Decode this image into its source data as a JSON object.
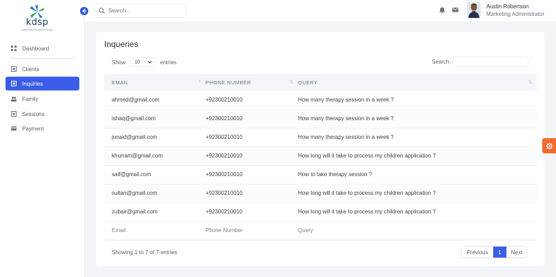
{
  "brand": {
    "logo_text": "kdsp",
    "tagline": "Kashif's Down Syndrome Program"
  },
  "sidebar": {
    "items": [
      {
        "label": "Dashboard",
        "icon": "grid-icon"
      },
      {
        "label": "Clients",
        "icon": "square-icon"
      },
      {
        "label": "Inquiries",
        "icon": "square-icon"
      },
      {
        "label": "Family",
        "icon": "users-icon"
      },
      {
        "label": "Sessions",
        "icon": "square-icon"
      },
      {
        "label": "Payment",
        "icon": "card-icon"
      }
    ],
    "active": "Inquiries"
  },
  "topbar": {
    "search_placeholder": "Search...",
    "user_name": "Austin Robertson",
    "user_role": "Marketing Administrator"
  },
  "page": {
    "title": "Inqueries",
    "show_label": "Show",
    "entries_select": "10",
    "entries_label": "entries",
    "search_label": "Search:"
  },
  "table": {
    "headers": [
      "EMAIL",
      "PHONE NUMBER",
      "QUERY"
    ],
    "rows": [
      [
        "ahmed@gmail.com",
        "+92300210010",
        "How many therapy session in a week ?"
      ],
      [
        "ishaq@gmail.com",
        "+92300210010",
        "How many therapy session in a week ?"
      ],
      [
        "junaid@gmail.com",
        "+92300210010",
        "How many therapy session in a week ?"
      ],
      [
        "khurram@gmail.com",
        "+92300210010",
        "How long will it take to process my children application ?"
      ],
      [
        "saif@gmail.com",
        "+92300210010",
        "How to take therapy session ?"
      ],
      [
        "sultan@gmail.com",
        "+92300210010",
        "How long will it take to process my children application ?"
      ],
      [
        "zubair@gmail.com",
        "+92300210010",
        "How long will it take to process my children application ?"
      ]
    ],
    "footer": [
      "Email",
      "Phone Number",
      "Query"
    ]
  },
  "pagination": {
    "info": "Showing 1 to 7 of 7 entries",
    "previous": "Previous",
    "page": "1",
    "next": "Next"
  },
  "colors": {
    "accent": "#3b5de7",
    "settings_tab": "#f26a2e"
  }
}
